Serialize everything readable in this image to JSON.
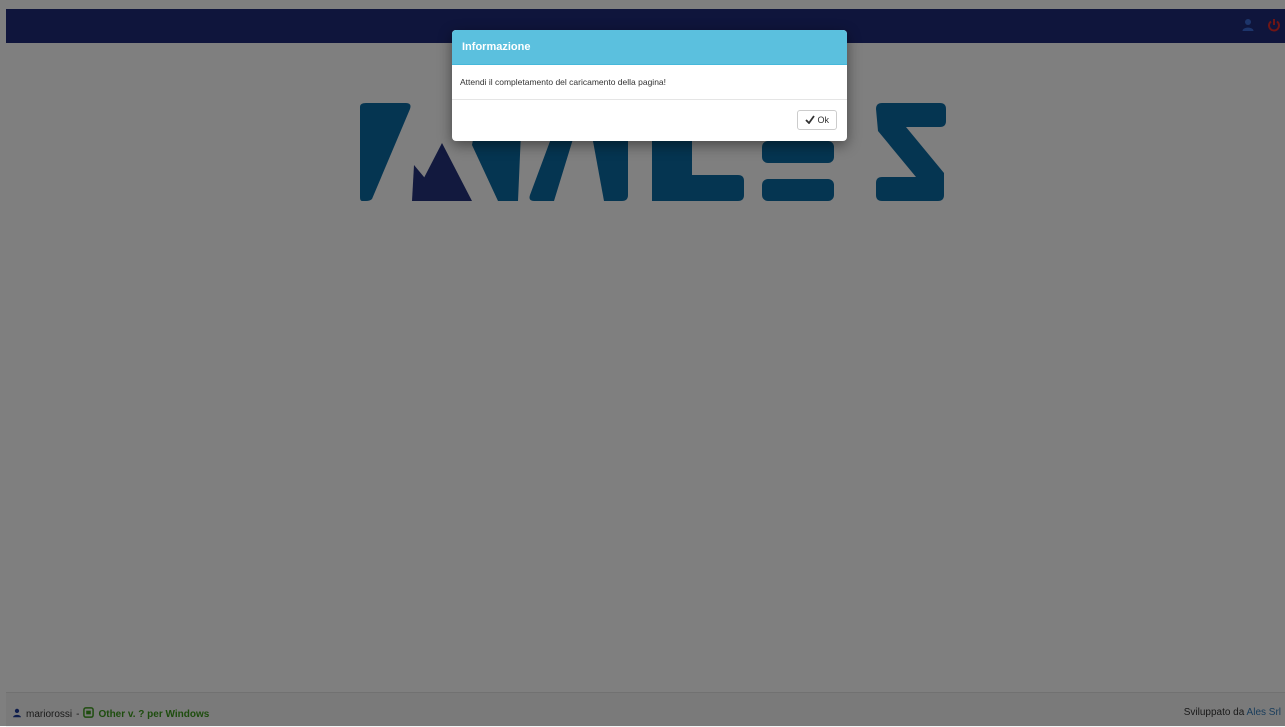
{
  "navbar": {
    "user_icon": "user-icon",
    "logout_icon": "power-off-icon"
  },
  "logo": {
    "text": "ALES",
    "primary_color": "#0b6aa3",
    "accent_color": "#25337c"
  },
  "footer": {
    "username": "mariorossi",
    "separator": "-",
    "app_label": "Other v. ? per Windows",
    "developed_by": "Sviluppato da",
    "company": "Ales Srl"
  },
  "modal": {
    "title": "Informazione",
    "message": "Attendi il completamento del caricamento della pagina!",
    "ok_label": "Ok"
  }
}
